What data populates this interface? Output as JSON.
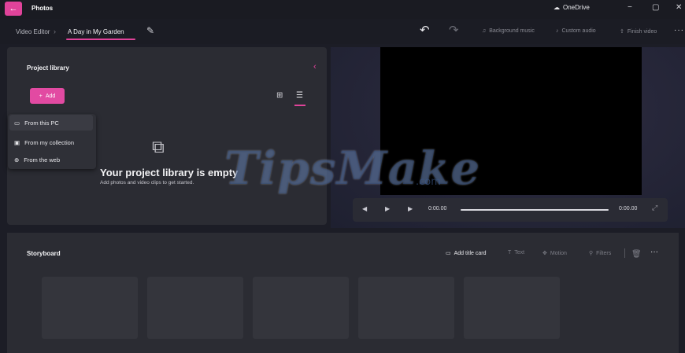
{
  "titlebar": {
    "app_name": "Photos",
    "onedrive_label": "OneDrive",
    "minimize": "−",
    "maximize": "▢",
    "close": "✕"
  },
  "toolbar": {
    "breadcrumb_root": "Video Editor",
    "breadcrumb_sep": "›",
    "project_name": "A Day in My Garden",
    "background_music": "Background music",
    "custom_audio": "Custom audio",
    "finish_video": "Finish video",
    "more": "···"
  },
  "library": {
    "title": "Project library",
    "add_label": "Add",
    "menu_items": [
      {
        "label": "From this PC",
        "icon": "pc-icon"
      },
      {
        "label": "From my collection",
        "icon": "collection-icon"
      },
      {
        "label": "From the web",
        "icon": "web-icon"
      }
    ],
    "empty_title": "Your project library is empty",
    "empty_subtitle": "Add photos and video clips to get started."
  },
  "preview": {
    "time_current": "0:00.00",
    "time_total": "0:00.00"
  },
  "storyboard": {
    "title": "Storyboard",
    "add_title_card": "Add title card",
    "text": "Text",
    "motion": "Motion",
    "filters": "Filters",
    "more": "···"
  },
  "watermark": {
    "main": "TipsMake",
    "suffix": ".com"
  },
  "colors": {
    "accent": "#e0439a",
    "background": "#1c1d26",
    "panel": "#2b2c33"
  }
}
